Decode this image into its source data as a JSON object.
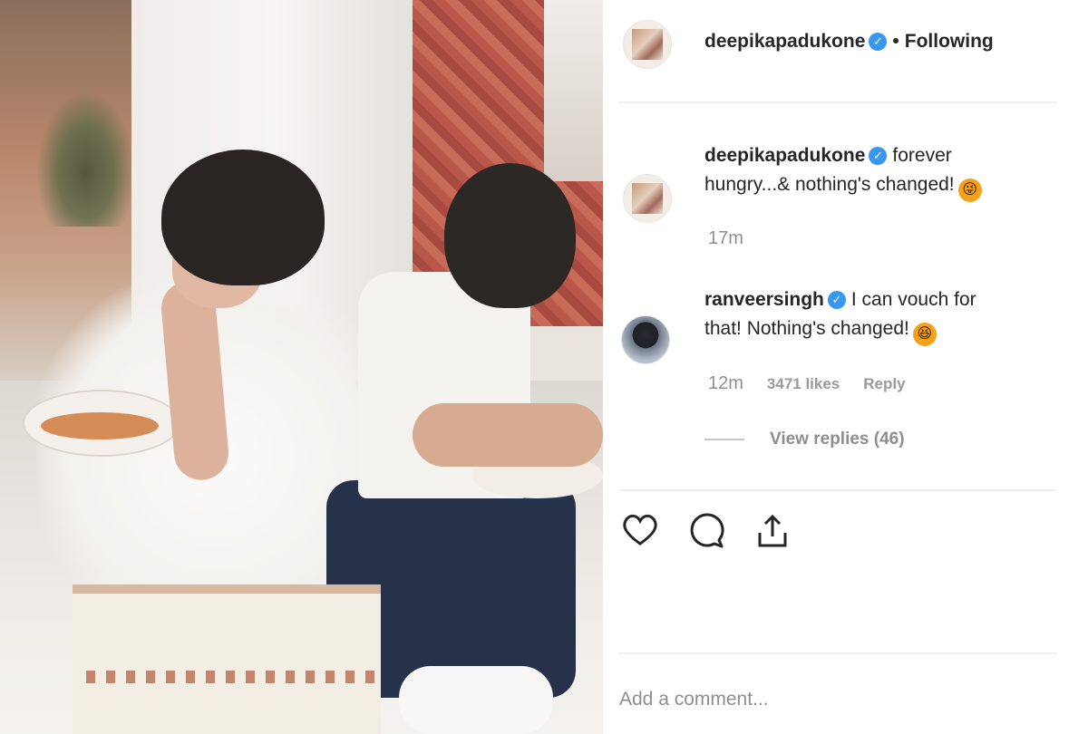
{
  "post": {
    "author": "deepikapadukone",
    "follow_sep": "•",
    "follow_status": "Following"
  },
  "comments": [
    {
      "username": "deepikapadukone",
      "text_line1": "forever",
      "text_line2": "hungry...& nothing's changed!",
      "emoji": "😜",
      "time": "17m"
    },
    {
      "username": "ranveersingh",
      "text_line1": "I can vouch for",
      "text_line2": "that! Nothing's changed!",
      "emoji": "😆",
      "time": "12m",
      "likes": "3471 likes",
      "reply_label": "Reply",
      "view_replies": "View replies (46)"
    }
  ],
  "actions": {
    "like_icon": "heart-icon",
    "comment_icon": "comment-icon",
    "share_icon": "share-icon"
  },
  "composer": {
    "placeholder": "Add a comment..."
  },
  "colors": {
    "verified": "#3897f0",
    "muted": "#8e8e8e",
    "text": "#262626"
  }
}
